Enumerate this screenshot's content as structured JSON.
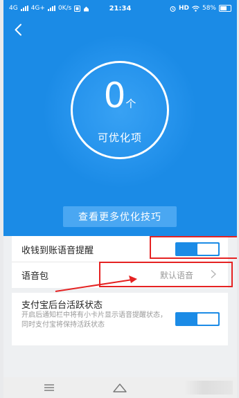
{
  "status_bar": {
    "network_1": "4G",
    "network_2": "4G+",
    "speed": "0K/s",
    "time": "21:34",
    "hd": "HD",
    "battery": "58%"
  },
  "header": {
    "back_icon": "chevron-left-icon"
  },
  "summary": {
    "count": "0",
    "unit": "个",
    "label": "可优化项"
  },
  "tips_button": {
    "label": "查看更多优化技巧"
  },
  "settings": {
    "voice_reminder": {
      "label": "收钱到账语音提醒",
      "enabled": true
    },
    "voice_pack": {
      "label": "语音包",
      "value": "默认语音"
    },
    "background_active": {
      "label": "支付宝后台活跃状态",
      "description": "开启后通知栏中将有小卡片显示语音提醒状态，同时支付宝将保持活跃状态",
      "enabled": true
    }
  },
  "nav_bar": {
    "menu_icon": "menu-icon",
    "home_icon": "home-icon"
  },
  "colors": {
    "primary_blue": "#1b8be6",
    "highlight_red": "#e52222"
  }
}
